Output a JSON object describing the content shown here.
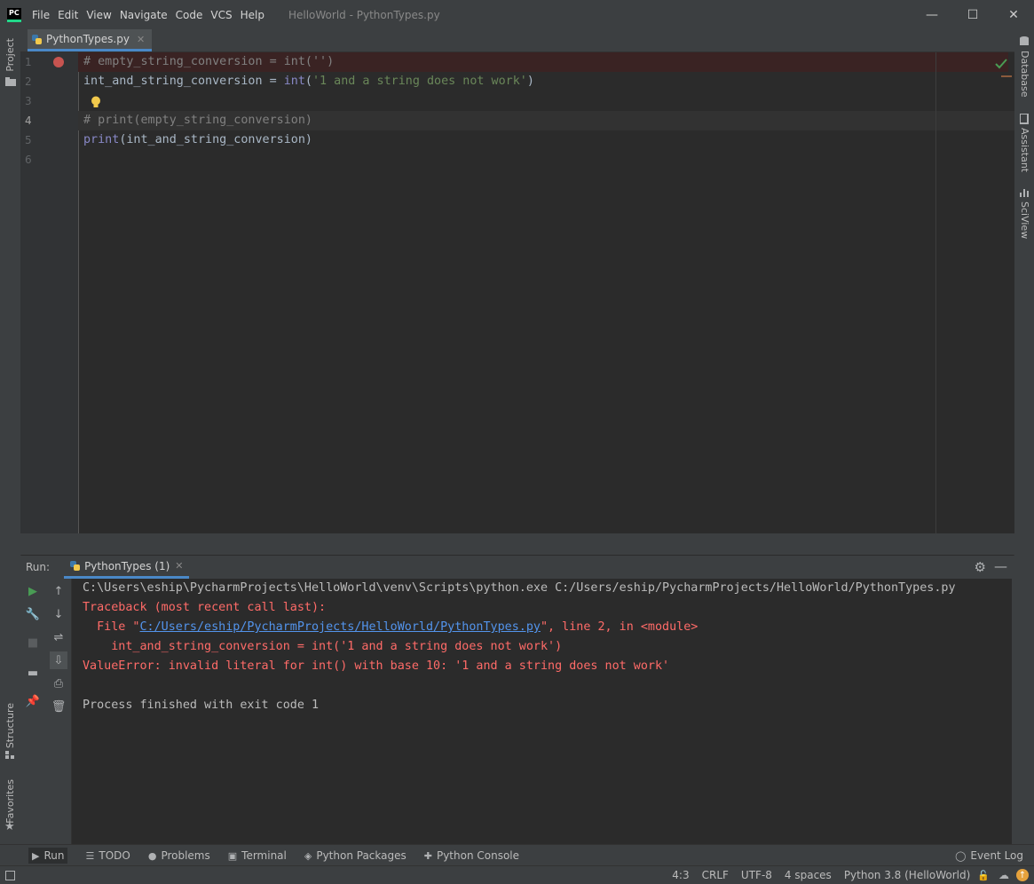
{
  "app": {
    "logo": "PC",
    "window_title": "HelloWorld - PythonTypes.py",
    "menu": [
      "File",
      "Edit",
      "View",
      "Navigate",
      "Code",
      "VCS",
      "Help"
    ],
    "window_controls": {
      "minimize": "—",
      "maximize": "☐",
      "close": "✕"
    }
  },
  "left_tools": {
    "project": "Project",
    "structure": "Structure",
    "favorites": "Favorites"
  },
  "right_tools": {
    "database": "Database",
    "assistant": "Assistant",
    "sciview": "SciView"
  },
  "editor": {
    "tab_label": "PythonTypes.py",
    "line_numbers": [
      "1",
      "2",
      "3",
      "4",
      "5",
      "6"
    ],
    "lines": {
      "l1": "# empty_string_conversion = int('')",
      "l2_ident": "int_and_string_conversion = ",
      "l2_func": "int",
      "l2_open": "(",
      "l2_str": "'1 and a string does not work'",
      "l2_close": ")",
      "l4": "# print(empty_string_conversion)",
      "l5_func": "print",
      "l5_rest": "(int_and_string_conversion)"
    }
  },
  "run": {
    "label": "Run:",
    "tab_label": "PythonTypes (1)",
    "output": {
      "cmd": "C:\\Users\\eship\\PycharmProjects\\HelloWorld\\venv\\Scripts\\python.exe C:/Users/eship/PycharmProjects/HelloWorld/PythonTypes.py",
      "traceback": "Traceback (most recent call last):",
      "file_prefix": "  File \"",
      "file_link": "C:/Users/eship/PycharmProjects/HelloWorld/PythonTypes.py",
      "file_suffix": "\", line 2, in <module>",
      "code_line": "    int_and_string_conversion = int('1 and a string does not work')",
      "error": "ValueError: invalid literal for int() with base 10: '1 and a string does not work'",
      "finished": "Process finished with exit code 1"
    }
  },
  "bottom_tools": {
    "run": "Run",
    "todo": "TODO",
    "problems": "Problems",
    "terminal": "Terminal",
    "python_packages": "Python Packages",
    "python_console": "Python Console",
    "event_log": "Event Log"
  },
  "status": {
    "position": "4:3",
    "line_sep": "CRLF",
    "encoding": "UTF-8",
    "indent": "4 spaces",
    "interpreter": "Python 3.8 (HelloWorld)"
  },
  "colors": {
    "accent": "#4a88c7",
    "error_text": "#ff6b68",
    "link": "#5394ec",
    "breakpoint": "#c75450",
    "run_green": "#499c54"
  }
}
